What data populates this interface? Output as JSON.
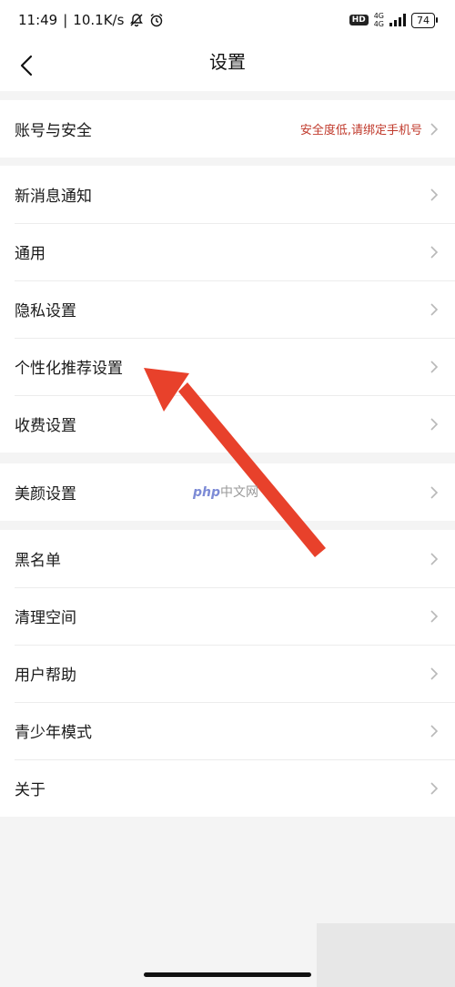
{
  "status_bar": {
    "time": "11:49",
    "speed": "10.1K/s",
    "hd": "HD",
    "network_top": "4G",
    "network_bottom": "4G",
    "battery": "74"
  },
  "header": {
    "title": "设置"
  },
  "groups": [
    {
      "items": [
        {
          "label": "账号与安全",
          "hint": "安全度低,请绑定手机号"
        }
      ]
    },
    {
      "items": [
        {
          "label": "新消息通知"
        },
        {
          "label": "通用"
        },
        {
          "label": "隐私设置"
        },
        {
          "label": "个性化推荐设置"
        },
        {
          "label": "收费设置"
        }
      ]
    },
    {
      "items": [
        {
          "label": "美颜设置"
        }
      ]
    },
    {
      "items": [
        {
          "label": "黑名单"
        },
        {
          "label": "清理空间"
        },
        {
          "label": "用户帮助"
        },
        {
          "label": "青少年模式"
        },
        {
          "label": "关于"
        }
      ]
    }
  ],
  "watermark": {
    "brand": "php",
    "text": "中文网"
  },
  "colors": {
    "hint": "#c0392b",
    "arrow": "#e8412b",
    "background": "#f4f4f4"
  }
}
